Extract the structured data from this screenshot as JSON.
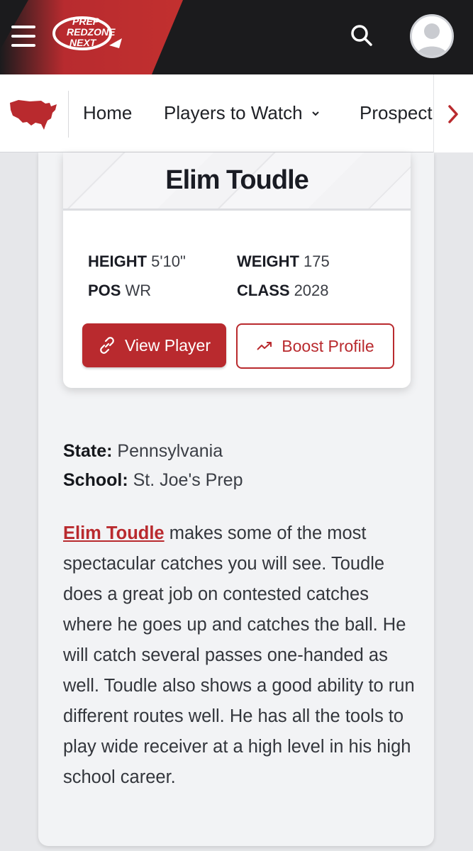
{
  "header": {
    "logo_text": [
      "PREP",
      "REDZONE",
      "NEXT"
    ],
    "menu_icon": "hamburger-menu-icon",
    "search_icon": "search-icon",
    "avatar_icon": "user-avatar-icon",
    "brand_color": "#b92a2e"
  },
  "nav": {
    "map_icon": "usa-map-icon",
    "items": [
      {
        "label": "Home"
      },
      {
        "label": "Players to Watch",
        "has_dropdown": true
      },
      {
        "label": "Prospect"
      }
    ],
    "scroll_icon": "chevron-right-icon"
  },
  "player": {
    "name": "Elim Toudle",
    "stats": {
      "height_label": "HEIGHT",
      "height_value": "5'10\"",
      "weight_label": "WEIGHT",
      "weight_value": "175",
      "pos_label": "POS",
      "pos_value": "WR",
      "class_label": "CLASS",
      "class_value": "2028"
    },
    "view_button": "View Player",
    "boost_button": "Boost Profile"
  },
  "info": {
    "state_label": "State:",
    "state_value": "Pennsylvania",
    "school_label": "School:",
    "school_value": "St. Joe's Prep"
  },
  "bio": {
    "link_text": "Elim Toudle",
    "text": " makes some of the most spectacular catches you will see. Toudle does a great job on contested catches where he goes up and catches the ball. He will catch several passes one-handed as well. Toudle also shows a good ability to run different routes well. He has all the tools to play wide receiver at a high level in his high school career."
  }
}
